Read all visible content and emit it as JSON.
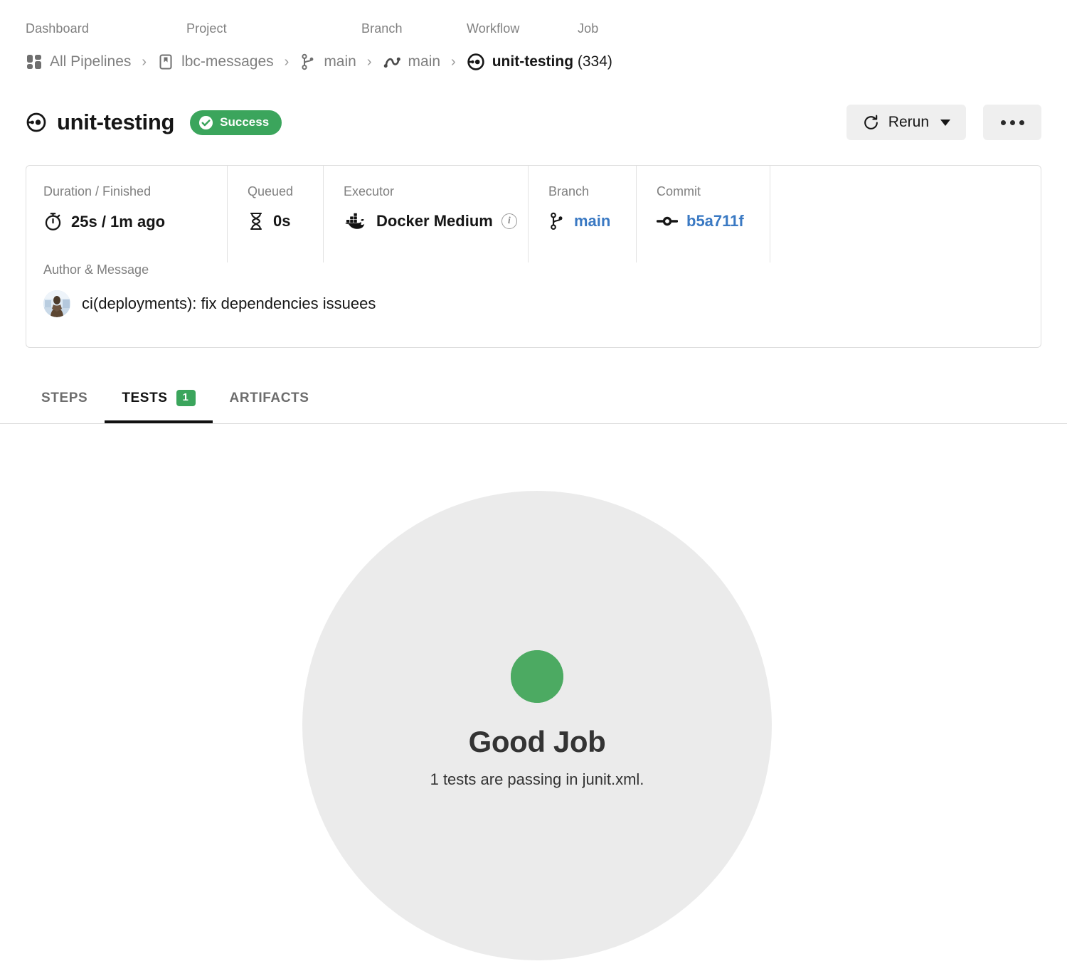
{
  "breadcrumb": {
    "labels": [
      "Dashboard",
      "Project",
      "Branch",
      "Workflow",
      "Job"
    ],
    "separator": "›",
    "items": [
      {
        "icon": "pipelines-grid-icon",
        "label": "All Pipelines"
      },
      {
        "icon": "project-bookmark-icon",
        "label": "lbc-messages"
      },
      {
        "icon": "branch-icon",
        "label": "main"
      },
      {
        "icon": "workflow-icon",
        "label": "main"
      },
      {
        "icon": "job-icon",
        "label": "unit-testing",
        "suffix": " (334)"
      }
    ]
  },
  "header": {
    "icon": "job-icon",
    "title": "unit-testing",
    "status": {
      "label": "Success",
      "icon": "check-circle-icon",
      "color": "#3ba55c"
    },
    "rerun_label": "Rerun",
    "rerun_icon": "refresh-icon",
    "more_icon": "ellipsis-icon"
  },
  "info_card": {
    "duration": {
      "label": "Duration / Finished",
      "value": "25s / 1m ago",
      "icon": "stopwatch-icon"
    },
    "queued": {
      "label": "Queued",
      "value": "0s",
      "icon": "hourglass-icon"
    },
    "executor": {
      "label": "Executor",
      "value": "Docker Medium",
      "icon": "docker-icon",
      "info_icon": "info-icon"
    },
    "branch": {
      "label": "Branch",
      "value": "main",
      "icon": "branch-icon",
      "link_color": "#3a79c3"
    },
    "commit": {
      "label": "Commit",
      "value": "b5a711f",
      "icon": "commit-icon",
      "link_color": "#3a79c3"
    },
    "author": {
      "label": "Author & Message",
      "message": "ci(deployments): fix dependencies issuees",
      "avatar": "user-avatar"
    }
  },
  "tabs": [
    {
      "label": "Steps",
      "active": false,
      "badge": null
    },
    {
      "label": "Tests",
      "active": true,
      "badge": "1"
    },
    {
      "label": "Artifacts",
      "active": false,
      "badge": null
    }
  ],
  "empty_state": {
    "logo": "circleci-logo",
    "heading": "Good Job",
    "subtext": "1 tests are passing in junit.xml.",
    "circle_color": "#ebebeb",
    "logo_color": "#4caa62"
  }
}
